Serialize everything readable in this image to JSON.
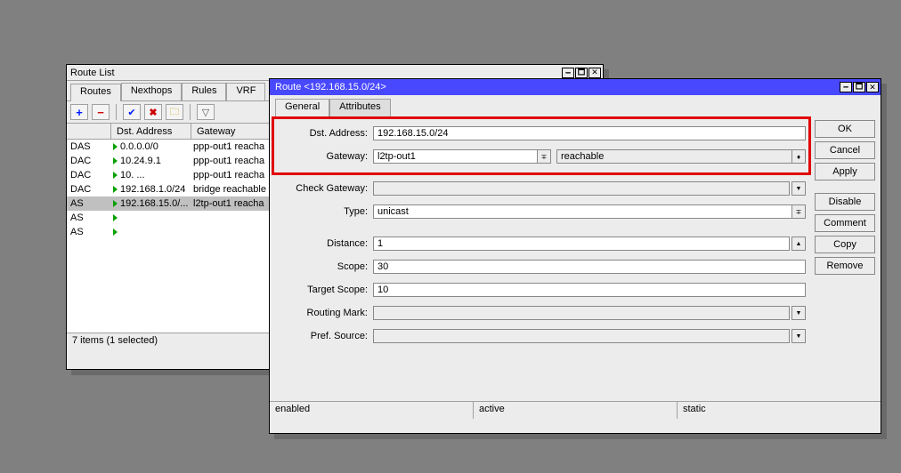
{
  "route_list": {
    "title": "Route List",
    "tabs": [
      "Routes",
      "Nexthops",
      "Rules",
      "VRF"
    ],
    "columns": {
      "dst": "Dst. Address",
      "gw": "Gateway"
    },
    "items": [
      {
        "flags": "DAS",
        "dst": "0.0.0.0/0",
        "gw": "ppp-out1 reacha",
        "sel": false
      },
      {
        "flags": "DAC",
        "dst": "10.24.9.1",
        "gw": "ppp-out1 reacha",
        "sel": false
      },
      {
        "flags": "DAC",
        "dst": "10. ...",
        "gw": "ppp-out1 reacha",
        "sel": false
      },
      {
        "flags": "DAC",
        "dst": "192.168.1.0/24",
        "gw": "bridge reachable",
        "sel": false
      },
      {
        "flags": "AS",
        "dst": "192.168.15.0/...",
        "gw": "l2tp-out1 reacha",
        "sel": true
      },
      {
        "flags": "AS",
        "dst": "",
        "gw": "",
        "sel": false
      },
      {
        "flags": "AS",
        "dst": "",
        "gw": "",
        "sel": false
      }
    ],
    "status": "7 items (1 selected)"
  },
  "route_dlg": {
    "title": "Route <192.168.15.0/24>",
    "tabs": {
      "general": "General",
      "attributes": "Attributes"
    },
    "labels": {
      "dst": "Dst. Address:",
      "gateway": "Gateway:",
      "check_gw": "Check Gateway:",
      "type": "Type:",
      "distance": "Distance:",
      "scope": "Scope:",
      "target_scope": "Target Scope:",
      "routing_mark": "Routing Mark:",
      "pref_source": "Pref. Source:"
    },
    "values": {
      "dst": "192.168.15.0/24",
      "gateway": "l2tp-out1",
      "gateway_status": "reachable",
      "check_gw": "",
      "type": "unicast",
      "distance": "1",
      "scope": "30",
      "target_scope": "10",
      "routing_mark": "",
      "pref_source": ""
    },
    "buttons": {
      "ok": "OK",
      "cancel": "Cancel",
      "apply": "Apply",
      "disable": "Disable",
      "comment": "Comment",
      "copy": "Copy",
      "remove": "Remove"
    },
    "status": {
      "enabled": "enabled",
      "active": "active",
      "static": "static"
    }
  }
}
